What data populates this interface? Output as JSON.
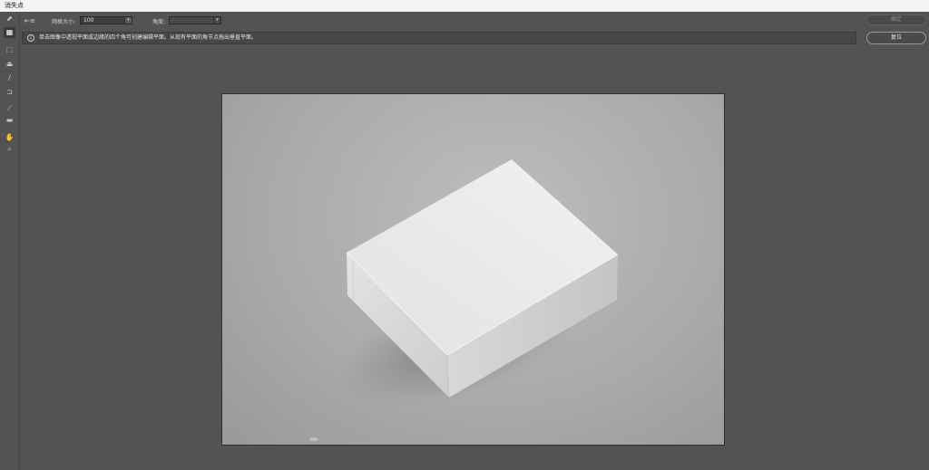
{
  "window": {
    "title": "消失点"
  },
  "options_bar": {
    "grid_size_label": "网格大小:",
    "grid_size_value": "100",
    "angle_label": "角度:",
    "angle_value": "",
    "ok_label": "确定",
    "reset_label": "复位"
  },
  "hint": {
    "text": "单击图像中透视平面或边缘的四个角可创建编辑平面。从现有平面的角节点拖出垂直平面。"
  },
  "toolbar": {
    "tools": [
      {
        "name": "edit-plane-tool-icon"
      },
      {
        "name": "create-plane-tool-icon"
      },
      {
        "name": "marquee-tool-icon"
      },
      {
        "name": "stamp-tool-icon"
      },
      {
        "name": "brush-tool-icon"
      },
      {
        "name": "transform-tool-icon"
      },
      {
        "name": "eyedropper-tool-icon"
      },
      {
        "name": "measure-tool-icon"
      },
      {
        "name": "hand-tool-icon"
      },
      {
        "name": "zoom-tool-icon"
      }
    ]
  },
  "colors": {
    "panel_bg": "#535353",
    "canvas_bg": "#a9a9a9",
    "box_top": "#ececec",
    "box_side_left": "#d9d9d9",
    "box_side_right": "#cfcfcf"
  }
}
